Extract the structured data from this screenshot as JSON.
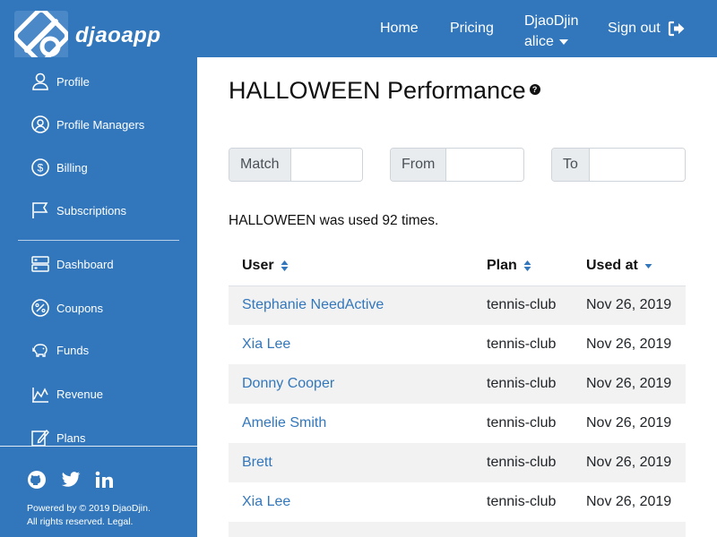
{
  "navbar": {
    "brand": "djaoapp",
    "links": {
      "home": "Home",
      "pricing": "Pricing",
      "user_line1": "DjaoDjin",
      "user_line2": "alice",
      "signout": "Sign out"
    }
  },
  "sidebar": {
    "items": [
      {
        "label": "Profile",
        "icon": "user-icon"
      },
      {
        "label": "Profile Managers",
        "icon": "user-circle-icon"
      },
      {
        "label": "Billing",
        "icon": "dollar-icon"
      },
      {
        "label": "Subscriptions",
        "icon": "flag-icon"
      },
      {
        "label": "Dashboard",
        "icon": "server-icon"
      },
      {
        "label": "Coupons",
        "icon": "percent-icon"
      },
      {
        "label": "Funds",
        "icon": "piggy-bank-icon"
      },
      {
        "label": "Revenue",
        "icon": "chart-icon"
      },
      {
        "label": "Plans",
        "icon": "edit-icon"
      }
    ],
    "footer": {
      "social": [
        "github-icon",
        "twitter-icon",
        "linkedin-icon"
      ],
      "copyright_line1": "Powered by © 2019 DjaoDjin.",
      "copyright_line2": "All rights reserved. Legal."
    }
  },
  "main": {
    "title": "HALLOWEEN Performance",
    "filters": {
      "match_label": "Match",
      "from_label": "From",
      "to_label": "To"
    },
    "usage_text": "HALLOWEEN was used 92 times.",
    "table": {
      "headers": {
        "user": "User",
        "plan": "Plan",
        "used_at": "Used at"
      },
      "rows": [
        {
          "user": "Stephanie NeedActive",
          "plan": "tennis-club",
          "used_at": "Nov 26, 2019"
        },
        {
          "user": "Xia Lee",
          "plan": "tennis-club",
          "used_at": "Nov 26, 2019"
        },
        {
          "user": "Donny Cooper",
          "plan": "tennis-club",
          "used_at": "Nov 26, 2019"
        },
        {
          "user": "Amelie Smith",
          "plan": "tennis-club",
          "used_at": "Nov 26, 2019"
        },
        {
          "user": "Brett",
          "plan": "tennis-club",
          "used_at": "Nov 26, 2019"
        },
        {
          "user": "Xia Lee",
          "plan": "tennis-club",
          "used_at": "Nov 26, 2019"
        }
      ]
    }
  },
  "colors": {
    "brand_blue": "#3277bc",
    "link_blue": "#3277bc",
    "row_stripe": "#f2f2f2"
  }
}
